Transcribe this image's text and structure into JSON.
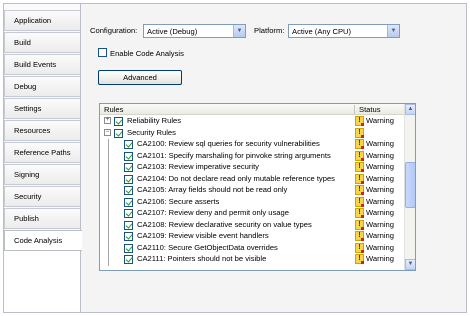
{
  "tabs": [
    {
      "label": "Application",
      "active": false
    },
    {
      "label": "Build",
      "active": false
    },
    {
      "label": "Build Events",
      "active": false
    },
    {
      "label": "Debug",
      "active": false
    },
    {
      "label": "Settings",
      "active": false
    },
    {
      "label": "Resources",
      "active": false
    },
    {
      "label": "Reference Paths",
      "active": false
    },
    {
      "label": "Signing",
      "active": false
    },
    {
      "label": "Security",
      "active": false
    },
    {
      "label": "Publish",
      "active": false
    },
    {
      "label": "Code Analysis",
      "active": true
    }
  ],
  "config": {
    "configuration_label": "Configuration:",
    "configuration_value": "Active (Debug)",
    "platform_label": "Platform:",
    "platform_value": "Active (Any CPU)"
  },
  "enable_label": "Enable Code Analysis",
  "advanced_label": "Advanced",
  "rules_grid": {
    "header_rules": "Rules",
    "header_status": "Status",
    "rows": [
      {
        "level": 0,
        "expander": "+",
        "checked": true,
        "name": "Reliability Rules",
        "status": "Warning"
      },
      {
        "level": 0,
        "expander": "−",
        "checked": true,
        "name": "Security Rules",
        "status": ""
      },
      {
        "level": 1,
        "checked": true,
        "name": "CA2100: Review sql queries for security vulnerabilities",
        "status": "Warning"
      },
      {
        "level": 1,
        "checked": true,
        "name": "CA2101: Specify marshaling for pinvoke string arguments",
        "status": "Warning"
      },
      {
        "level": 1,
        "checked": true,
        "name": "CA2103: Review imperative security",
        "status": "Warning"
      },
      {
        "level": 1,
        "checked": true,
        "name": "CA2104: Do not declare read only mutable reference types",
        "status": "Warning"
      },
      {
        "level": 1,
        "checked": true,
        "name": "CA2105: Array fields should not be read only",
        "status": "Warning"
      },
      {
        "level": 1,
        "checked": true,
        "name": "CA2106: Secure asserts",
        "status": "Warning"
      },
      {
        "level": 1,
        "checked": true,
        "name": "CA2107: Review deny and permit only usage",
        "status": "Warning"
      },
      {
        "level": 1,
        "checked": true,
        "name": "CA2108: Review declarative security on value types",
        "status": "Warning"
      },
      {
        "level": 1,
        "checked": true,
        "name": "CA2109: Review visible event handlers",
        "status": "Warning"
      },
      {
        "level": 1,
        "checked": true,
        "name": "CA2110: Secure GetObjectData overrides",
        "status": "Warning"
      },
      {
        "level": 1,
        "checked": true,
        "name": "CA2111: Pointers should not be visible",
        "status": "Warning"
      }
    ]
  },
  "icons": {
    "warning": "warning-icon",
    "combo_arrow": "chevron-down-icon",
    "scroll_up": "arrow-up-icon",
    "scroll_down": "arrow-down-icon"
  },
  "colors": {
    "border": "#b9bec8",
    "input_border": "#7f9db9",
    "check": "#21a121",
    "warning_icon": "#f7d54a"
  }
}
